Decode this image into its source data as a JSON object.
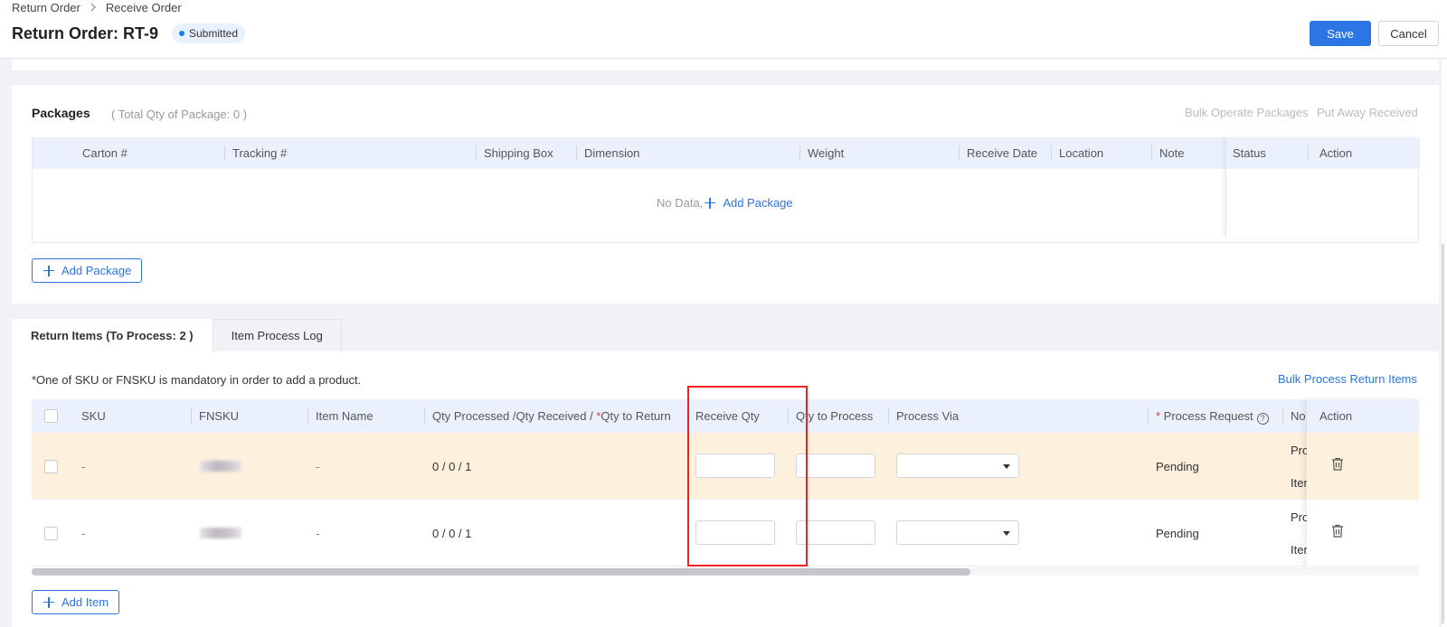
{
  "breadcrumb": {
    "items": [
      "Return Order",
      "Receive Order"
    ]
  },
  "header": {
    "title": "Return Order: RT-9",
    "status": "Submitted",
    "save_label": "Save",
    "cancel_label": "Cancel"
  },
  "packages": {
    "title": "Packages",
    "total": "( Total Qty of Package: 0 )",
    "bulk_operate": "Bulk Operate Packages",
    "put_away": "Put Away Received",
    "columns": [
      "Carton #",
      "Tracking #",
      "Shipping Box",
      "Dimension",
      "Weight",
      "Receive Date",
      "Location",
      "Note",
      "Status",
      "Action"
    ],
    "no_data": "No Data,",
    "add_link": "Add Package",
    "add_button": "Add Package"
  },
  "tabs": [
    {
      "label": "Return Items (To Process: 2 )",
      "active": true
    },
    {
      "label": "Item Process Log",
      "active": false
    }
  ],
  "items": {
    "note": "*One of SKU or FNSKU is mandatory in order to add a product.",
    "bulk_process": "Bulk Process Return Items",
    "columns": {
      "sku": "SKU",
      "fnsku": "FNSKU",
      "item_name": "Item Name",
      "qty_prefix": "Qty Processed /Qty Received / ",
      "qty_req": "*",
      "qty_suffix": "Qty to Return",
      "receive_qty": "Receive Qty",
      "qty_to_process": "Qty to Process",
      "process_via": "Process Via",
      "process_request_req": "* ",
      "process_request": "Process Request",
      "help_glyph": "?",
      "note": "No",
      "action": "Action"
    },
    "rows": [
      {
        "sku": "-",
        "item_name": "-",
        "qty": "0 / 0 / 1",
        "receive_qty": "",
        "qty_to_process": "",
        "process_via": "",
        "process_request": "Pending",
        "note_line1": "Pro",
        "note_line2": "Iter"
      },
      {
        "sku": "-",
        "item_name": "-",
        "qty": "0 / 0 / 1",
        "receive_qty": "",
        "qty_to_process": "",
        "process_via": "",
        "process_request": "Pending",
        "note_line1": "Pro",
        "note_line2": "Iter"
      }
    ],
    "add_button": "Add Item"
  },
  "colors": {
    "accent": "#2b76e4",
    "highlight_row": "#fdf0dd",
    "annotation": "#ee2222"
  },
  "icons": [
    "chevron-right-icon",
    "status-dot-icon",
    "plus-icon",
    "help-circle-icon",
    "trash-icon",
    "dropdown-caret-icon"
  ]
}
